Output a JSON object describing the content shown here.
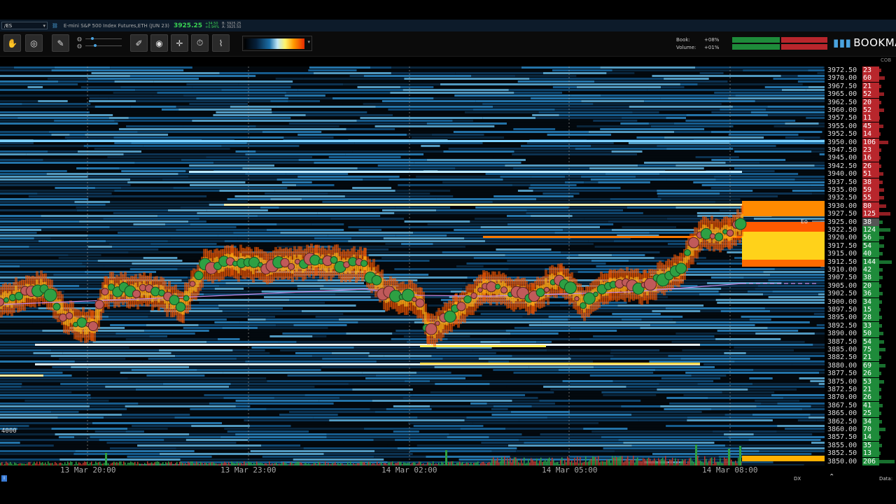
{
  "titlebar": {
    "symbol": "/ES",
    "instrument": "E-mini S&P 500 Index Futures,ETH (JUN 23)",
    "last_price": "3925.25",
    "change_abs": "+34.50",
    "change_pct": "+0.94%",
    "bid": "B: 3925.25",
    "ask": "A: 3925.50"
  },
  "toolbar": {
    "tools": [
      "hand-icon",
      "crosshair-target-icon",
      "brush-icon",
      "pencil-icon",
      "comment-icon",
      "crosshair-icon",
      "timer-icon",
      "indicator-icon"
    ],
    "book_label": "Book:",
    "book_value": "+08%",
    "volume_label": "Volume:",
    "volume_value": "+01%",
    "logo_text": "BOOKMA",
    "colors": {
      "bid": "#1e8b3a",
      "ask": "#b8262c"
    }
  },
  "chart": {
    "time_labels": [
      "13 Mar 20:00",
      "13 Mar 23:00",
      "14 Mar 02:00",
      "14 Mar 05:00",
      "14 Mar 08:00"
    ],
    "left_label": "4000",
    "vwap_color": "#c58be8",
    "marker_label": "Eo"
  },
  "ladder": {
    "header": "COB",
    "rows": [
      {
        "price": "3972.50",
        "size": "23",
        "side": "ask"
      },
      {
        "price": "3970.00",
        "size": "60",
        "side": "ask"
      },
      {
        "price": "3967.50",
        "size": "21",
        "side": "ask"
      },
      {
        "price": "3965.00",
        "size": "52",
        "side": "ask"
      },
      {
        "price": "3962.50",
        "size": "20",
        "side": "ask"
      },
      {
        "price": "3960.00",
        "size": "52",
        "side": "ask"
      },
      {
        "price": "3957.50",
        "size": "11",
        "side": "ask"
      },
      {
        "price": "3955.00",
        "size": "45",
        "side": "ask"
      },
      {
        "price": "3952.50",
        "size": "14",
        "side": "ask"
      },
      {
        "price": "3950.00",
        "size": "106",
        "side": "ask"
      },
      {
        "price": "3947.50",
        "size": "23",
        "side": "ask"
      },
      {
        "price": "3945.00",
        "size": "16",
        "side": "ask"
      },
      {
        "price": "3942.50",
        "size": "26",
        "side": "ask"
      },
      {
        "price": "3940.00",
        "size": "51",
        "side": "ask"
      },
      {
        "price": "3937.50",
        "size": "38",
        "side": "ask"
      },
      {
        "price": "3935.00",
        "size": "59",
        "side": "ask"
      },
      {
        "price": "3932.50",
        "size": "55",
        "side": "ask"
      },
      {
        "price": "3930.00",
        "size": "80",
        "side": "ask"
      },
      {
        "price": "3927.50",
        "size": "125",
        "side": "ask"
      },
      {
        "price": "3925.00",
        "size": "38",
        "side": "current"
      },
      {
        "price": "3922.50",
        "size": "124",
        "side": "bid"
      },
      {
        "price": "3920.00",
        "size": "56",
        "side": "bid"
      },
      {
        "price": "3917.50",
        "size": "54",
        "side": "bid"
      },
      {
        "price": "3915.00",
        "size": "40",
        "side": "bid"
      },
      {
        "price": "3912.50",
        "size": "144",
        "side": "bid"
      },
      {
        "price": "3910.00",
        "size": "42",
        "side": "bid"
      },
      {
        "price": "3907.50",
        "size": "38",
        "side": "bid"
      },
      {
        "price": "3905.00",
        "size": "20",
        "side": "bid"
      },
      {
        "price": "3902.50",
        "size": "36",
        "side": "bid"
      },
      {
        "price": "3900.00",
        "size": "34",
        "side": "bid"
      },
      {
        "price": "3897.50",
        "size": "15",
        "side": "bid"
      },
      {
        "price": "3895.00",
        "size": "28",
        "side": "bid"
      },
      {
        "price": "3892.50",
        "size": "33",
        "side": "bid"
      },
      {
        "price": "3890.00",
        "size": "50",
        "side": "bid"
      },
      {
        "price": "3887.50",
        "size": "54",
        "side": "bid"
      },
      {
        "price": "3885.00",
        "size": "75",
        "side": "bid"
      },
      {
        "price": "3882.50",
        "size": "21",
        "side": "bid"
      },
      {
        "price": "3880.00",
        "size": "69",
        "side": "bid"
      },
      {
        "price": "3877.50",
        "size": "26",
        "side": "bid"
      },
      {
        "price": "3875.00",
        "size": "53",
        "side": "bid"
      },
      {
        "price": "3872.50",
        "size": "21",
        "side": "bid"
      },
      {
        "price": "3870.00",
        "size": "26",
        "side": "bid"
      },
      {
        "price": "3867.50",
        "size": "41",
        "side": "bid"
      },
      {
        "price": "3865.00",
        "size": "25",
        "side": "bid"
      },
      {
        "price": "3862.50",
        "size": "34",
        "side": "bid"
      },
      {
        "price": "3860.00",
        "size": "70",
        "side": "bid"
      },
      {
        "price": "3857.50",
        "size": "14",
        "side": "bid"
      },
      {
        "price": "3855.00",
        "size": "35",
        "side": "bid"
      },
      {
        "price": "3852.50",
        "size": "13",
        "side": "bid"
      },
      {
        "price": "3850.00",
        "size": "206",
        "side": "bid"
      }
    ]
  },
  "bottombar": {
    "dx_label": "DX",
    "data_label": "Data:"
  }
}
